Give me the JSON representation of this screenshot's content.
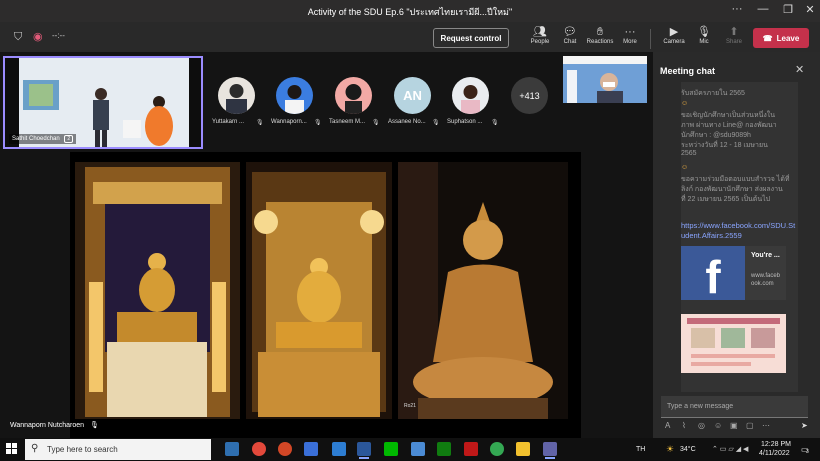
{
  "window": {
    "title": "Activity of the SDU Ep.6 \"ประเทศไทยเรามีผี...ปีใหม่\""
  },
  "toolbar": {
    "timer": "--:--",
    "request_control": "Request control",
    "tools": [
      {
        "label": "People",
        "icon": "people-icon"
      },
      {
        "label": "Chat",
        "icon": "chat-icon"
      },
      {
        "label": "Reactions",
        "icon": "reactions-icon"
      },
      {
        "label": "More",
        "icon": "more-icon"
      },
      {
        "label": "Camera",
        "icon": "camera-icon"
      },
      {
        "label": "Mic",
        "icon": "mic-icon"
      },
      {
        "label": "Share",
        "icon": "share-icon"
      }
    ],
    "leave": "Leave"
  },
  "stage": {
    "spotlight_name": "Sathit Choedchan",
    "spotlight_count": "2",
    "participants": [
      {
        "name": "Yuttakarn ...",
        "color": "#e8e4de"
      },
      {
        "name": "Wannaporn...",
        "color": "#3b7de0"
      },
      {
        "name": "Tasneem M...",
        "color": "#f2a9a5"
      },
      {
        "name": "Assanee No...",
        "initials": "AN",
        "color": "#b6d4e0"
      },
      {
        "name": "Suphatson ...",
        "color": "#e9ecef"
      }
    ],
    "more_count": "+413",
    "presenter_name": "Wannaporn Nutcharoen",
    "slide_caption": "Ro21"
  },
  "chat": {
    "title": "Meeting chat",
    "lines": [
      "รับสมัครภายใน 2565",
      "ขอเชิญนักศึกษาเป็นส่วนหนึ่งใน",
      "ภาพ ผ่านทาง Line@ กองพัฒนา",
      "นักศึกษา : @sdu9089h",
      "ระหว่างวันที่ 12 - 18 เมษายน",
      "2565",
      "ขอความร่วมมือตอบแบบสำรวจ ได้ที่",
      "ลิงก์ กองพัฒนานักศึกษา ส่งผลงาน",
      "ที่ 22 เมษายน 2565 เป็นต้นไป"
    ],
    "link": "https://www.facebook.com/SDU.Student.Affairs.2559",
    "card_title": "You're ...",
    "card_domain": "www.facebook.com",
    "input_placeholder": "Type a new message"
  },
  "taskbar": {
    "search_placeholder": "Type here to search",
    "language": "TH",
    "weather": "34°C",
    "time": "12:28 PM",
    "date": "4/11/2022",
    "notifications": "3"
  }
}
